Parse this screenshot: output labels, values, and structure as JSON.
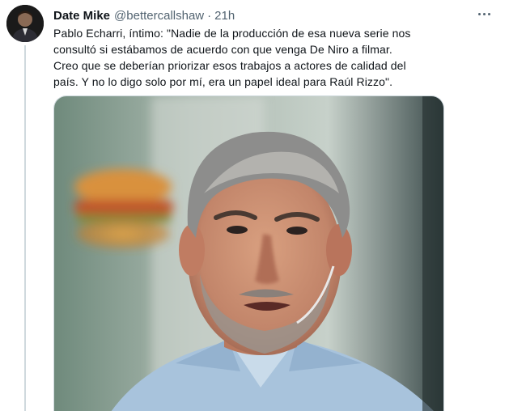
{
  "tweet": {
    "author_name": "Date Mike",
    "handle": "@bettercallshaw",
    "separator": "·",
    "time": "21h",
    "text": "Pablo Echarri, íntimo: \"Nadie de la producción de esa nueva serie nos consultó si estábamos de acuerdo con que venga De Niro a filmar. Creo que se deberían priorizar esos trabajos a actores de calidad del país. Y no lo digo solo por mí, era un papel ideal para Raúl Rizzo\"."
  },
  "icons": {
    "more": "more-horizontal-icon"
  }
}
